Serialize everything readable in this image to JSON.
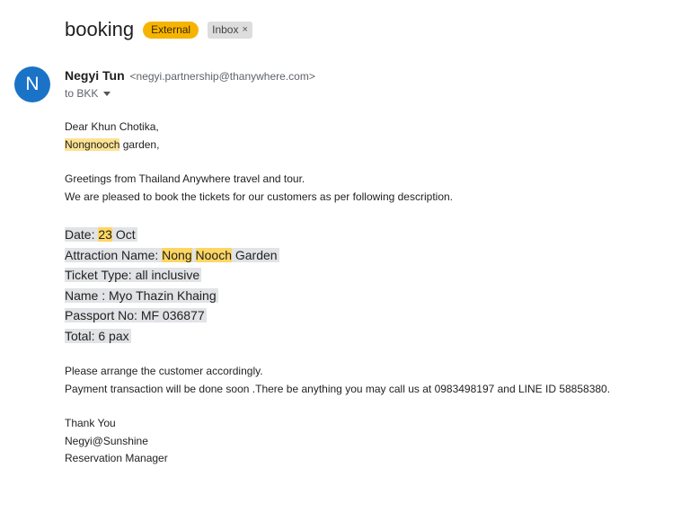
{
  "subject": {
    "title": "booking",
    "labels": {
      "external": "External",
      "inbox": "Inbox",
      "inbox_remove": "×"
    }
  },
  "sender": {
    "avatar_letter": "N",
    "avatar_color": "#1a73c7",
    "name": "Negyi Tun",
    "email": "<negyi.partnership@thanywhere.com>",
    "to": "to BKK"
  },
  "body": {
    "greeting": "Dear Khun Chotika,",
    "recipient_place_hl": "Nongnooch",
    "recipient_place_rest": " garden,",
    "intro_1": "Greetings from Thailand Anywhere travel and tour.",
    "intro_2": "We are pleased to book the tickets for our customers as per following description.",
    "details": {
      "date_prefix": "Date: ",
      "date_hl": "23",
      "date_rest": " Oct",
      "attraction_prefix": "Attraction Name: ",
      "attraction_hl1": "Nong",
      "attraction_space": " ",
      "attraction_hl2": "Nooch",
      "attraction_rest": " Garden",
      "ticket_type": "Ticket Type: all inclusive",
      "name": "Name : Myo Thazin Khaing",
      "passport": "Passport No: MF 036877",
      "total": "Total: 6 pax"
    },
    "closing_1": "Please arrange the customer accordingly.",
    "closing_2": "Payment transaction will be done soon .There be anything you may call us at 0983498197 and LINE ID 58858380.",
    "sign_1": "Thank You",
    "sign_2": "Negyi@Sunshine",
    "sign_3": "Reservation Manager"
  },
  "colors": {
    "highlight": "#fde293",
    "external_chip": "#f6b400"
  }
}
